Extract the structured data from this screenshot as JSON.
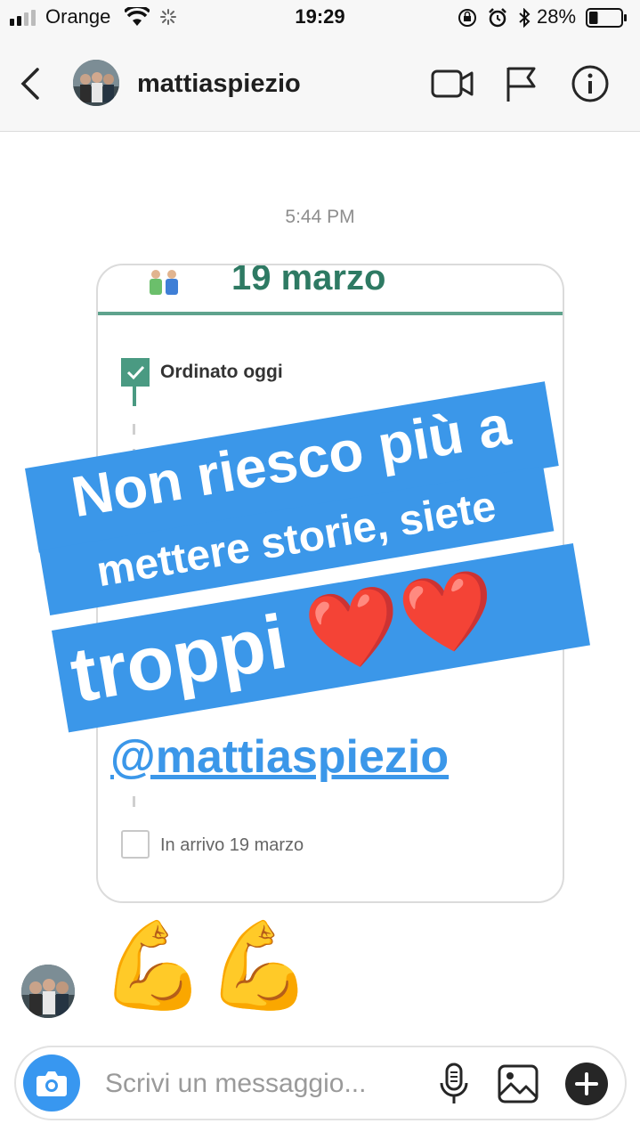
{
  "status_bar": {
    "carrier": "Orange",
    "time": "19:29",
    "battery_percent": "28%",
    "battery_level": 0.28
  },
  "header": {
    "username": "mattiaspiezio",
    "icons": [
      "back-chevron-icon",
      "video-call-icon",
      "flag-icon",
      "info-icon"
    ]
  },
  "conversation": {
    "timestamp": "5:44 PM",
    "story_reply": {
      "date_text": "19 marzo",
      "ordered_text": "Ordinato oggi",
      "arrival_text": "In arrivo 19 marzo",
      "banner_lines": [
        "Non riesco più a",
        "mettere storie, siete",
        "troppi ❤️❤️"
      ],
      "mention": "@mattiaspiezio",
      "banner_color": "#3b97e9"
    },
    "message_emoji": "💪💪"
  },
  "composer": {
    "placeholder": "Scrivi un messaggio...",
    "icons": [
      "camera-icon",
      "microphone-icon",
      "gallery-icon",
      "add-icon"
    ],
    "accent_color": "#3897f0"
  }
}
